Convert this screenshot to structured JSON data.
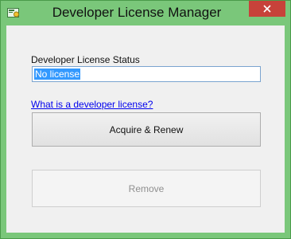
{
  "window": {
    "title": "Developer License Manager",
    "accent_color": "#7ac77a"
  },
  "status": {
    "label": "Developer License Status",
    "value": "No license"
  },
  "help_link": "What is a developer license?",
  "buttons": {
    "acquire": "Acquire & Renew",
    "remove": "Remove",
    "remove_enabled": false
  },
  "icons": {
    "app": "license-manager-icon",
    "close": "close-icon"
  }
}
